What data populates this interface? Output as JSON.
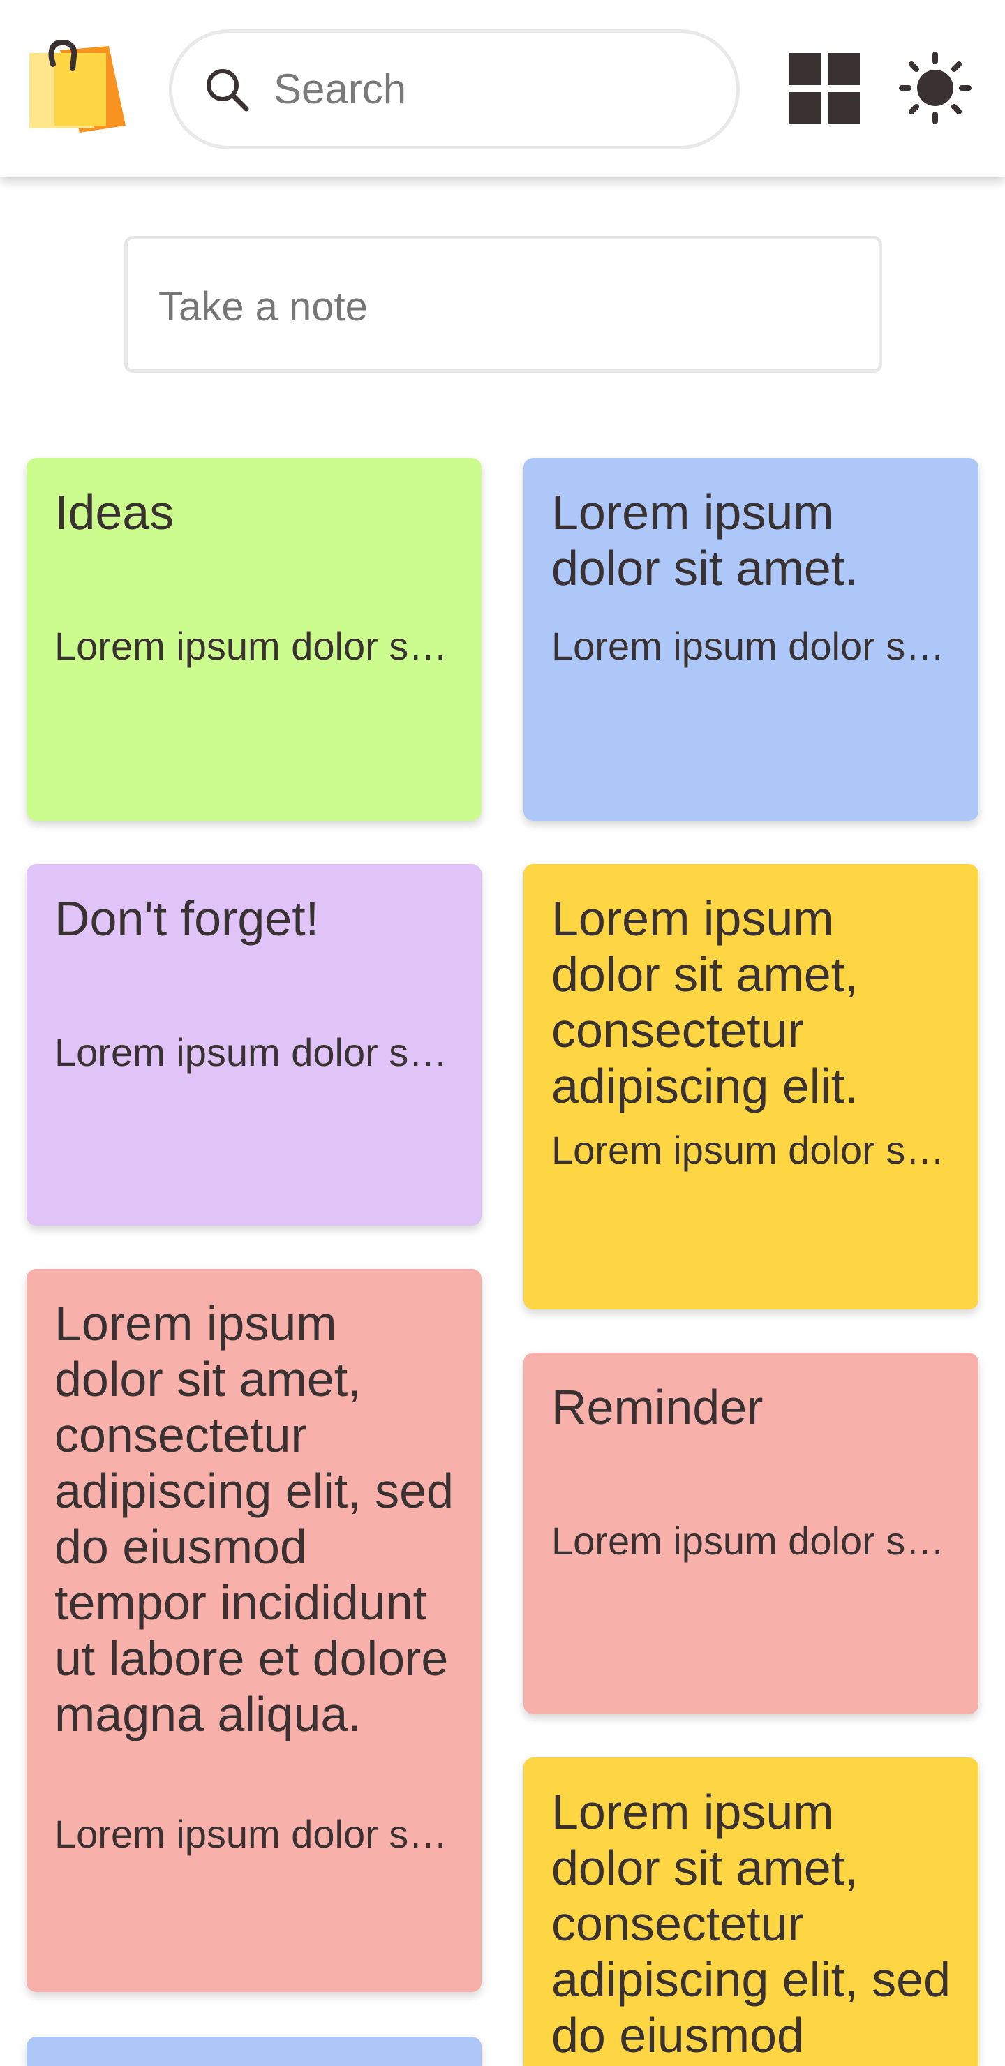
{
  "header": {
    "search_placeholder": "Search"
  },
  "composer": {
    "placeholder": "Take a note"
  },
  "colors": {
    "green": "#ccfc8e",
    "blue": "#adc8f8",
    "purple": "#e0c4f8",
    "yellow": "#fed644",
    "pink": "#f8b0aa"
  },
  "notes": [
    {
      "title": "Ideas",
      "body": "Lorem ipsum dolor sit amet",
      "color": "green"
    },
    {
      "title": "Lorem ipsum dolor sit amet.",
      "body": "Lorem ipsum dolor sit amet",
      "color": "blue"
    },
    {
      "title": "Don't forget!",
      "body": "Lorem ipsum dolor sit amet",
      "color": "purple"
    },
    {
      "title": "Lorem ipsum dolor sit amet, consectetur adipiscing elit.",
      "body": "Lorem ipsum dolor sit amet",
      "color": "yellow"
    },
    {
      "title": "Lorem ipsum dolor sit amet, consectetur adipiscing elit, sed do eiusmod tempor incididunt ut labore et dolore magna aliqua.",
      "body": "Lorem ipsum dolor sit amet",
      "color": "pink"
    },
    {
      "title": "Reminder",
      "body": "Lorem ipsum dolor sit amet",
      "color": "pink"
    },
    {
      "title": "Lorem ipsum dolor sit amet, consectetur adipiscing elit, sed do eiusmod",
      "body": "",
      "color": "yellow"
    },
    {
      "title": "",
      "body": "",
      "color": "blue"
    }
  ]
}
